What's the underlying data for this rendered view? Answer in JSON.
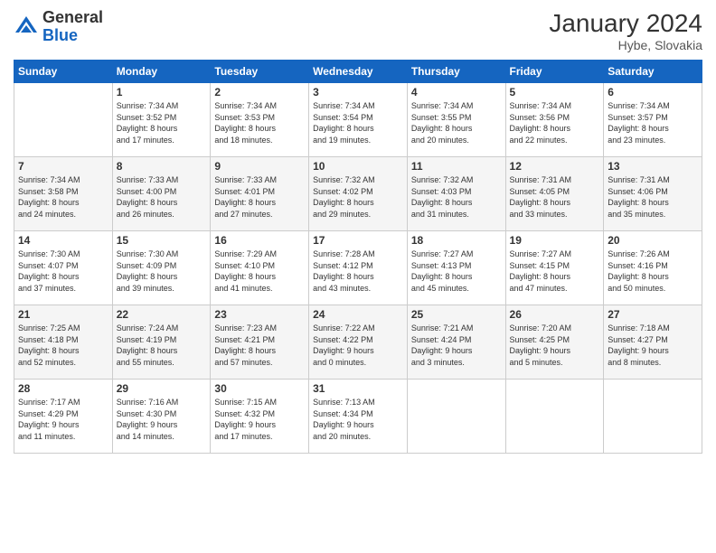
{
  "header": {
    "logo_general": "General",
    "logo_blue": "Blue",
    "month_year": "January 2024",
    "location": "Hybe, Slovakia"
  },
  "days_of_week": [
    "Sunday",
    "Monday",
    "Tuesday",
    "Wednesday",
    "Thursday",
    "Friday",
    "Saturday"
  ],
  "weeks": [
    {
      "days": [
        {
          "num": "",
          "info": ""
        },
        {
          "num": "1",
          "info": "Sunrise: 7:34 AM\nSunset: 3:52 PM\nDaylight: 8 hours\nand 17 minutes."
        },
        {
          "num": "2",
          "info": "Sunrise: 7:34 AM\nSunset: 3:53 PM\nDaylight: 8 hours\nand 18 minutes."
        },
        {
          "num": "3",
          "info": "Sunrise: 7:34 AM\nSunset: 3:54 PM\nDaylight: 8 hours\nand 19 minutes."
        },
        {
          "num": "4",
          "info": "Sunrise: 7:34 AM\nSunset: 3:55 PM\nDaylight: 8 hours\nand 20 minutes."
        },
        {
          "num": "5",
          "info": "Sunrise: 7:34 AM\nSunset: 3:56 PM\nDaylight: 8 hours\nand 22 minutes."
        },
        {
          "num": "6",
          "info": "Sunrise: 7:34 AM\nSunset: 3:57 PM\nDaylight: 8 hours\nand 23 minutes."
        }
      ]
    },
    {
      "days": [
        {
          "num": "7",
          "info": "Sunrise: 7:34 AM\nSunset: 3:58 PM\nDaylight: 8 hours\nand 24 minutes."
        },
        {
          "num": "8",
          "info": "Sunrise: 7:33 AM\nSunset: 4:00 PM\nDaylight: 8 hours\nand 26 minutes."
        },
        {
          "num": "9",
          "info": "Sunrise: 7:33 AM\nSunset: 4:01 PM\nDaylight: 8 hours\nand 27 minutes."
        },
        {
          "num": "10",
          "info": "Sunrise: 7:32 AM\nSunset: 4:02 PM\nDaylight: 8 hours\nand 29 minutes."
        },
        {
          "num": "11",
          "info": "Sunrise: 7:32 AM\nSunset: 4:03 PM\nDaylight: 8 hours\nand 31 minutes."
        },
        {
          "num": "12",
          "info": "Sunrise: 7:31 AM\nSunset: 4:05 PM\nDaylight: 8 hours\nand 33 minutes."
        },
        {
          "num": "13",
          "info": "Sunrise: 7:31 AM\nSunset: 4:06 PM\nDaylight: 8 hours\nand 35 minutes."
        }
      ]
    },
    {
      "days": [
        {
          "num": "14",
          "info": "Sunrise: 7:30 AM\nSunset: 4:07 PM\nDaylight: 8 hours\nand 37 minutes."
        },
        {
          "num": "15",
          "info": "Sunrise: 7:30 AM\nSunset: 4:09 PM\nDaylight: 8 hours\nand 39 minutes."
        },
        {
          "num": "16",
          "info": "Sunrise: 7:29 AM\nSunset: 4:10 PM\nDaylight: 8 hours\nand 41 minutes."
        },
        {
          "num": "17",
          "info": "Sunrise: 7:28 AM\nSunset: 4:12 PM\nDaylight: 8 hours\nand 43 minutes."
        },
        {
          "num": "18",
          "info": "Sunrise: 7:27 AM\nSunset: 4:13 PM\nDaylight: 8 hours\nand 45 minutes."
        },
        {
          "num": "19",
          "info": "Sunrise: 7:27 AM\nSunset: 4:15 PM\nDaylight: 8 hours\nand 47 minutes."
        },
        {
          "num": "20",
          "info": "Sunrise: 7:26 AM\nSunset: 4:16 PM\nDaylight: 8 hours\nand 50 minutes."
        }
      ]
    },
    {
      "days": [
        {
          "num": "21",
          "info": "Sunrise: 7:25 AM\nSunset: 4:18 PM\nDaylight: 8 hours\nand 52 minutes."
        },
        {
          "num": "22",
          "info": "Sunrise: 7:24 AM\nSunset: 4:19 PM\nDaylight: 8 hours\nand 55 minutes."
        },
        {
          "num": "23",
          "info": "Sunrise: 7:23 AM\nSunset: 4:21 PM\nDaylight: 8 hours\nand 57 minutes."
        },
        {
          "num": "24",
          "info": "Sunrise: 7:22 AM\nSunset: 4:22 PM\nDaylight: 9 hours\nand 0 minutes."
        },
        {
          "num": "25",
          "info": "Sunrise: 7:21 AM\nSunset: 4:24 PM\nDaylight: 9 hours\nand 3 minutes."
        },
        {
          "num": "26",
          "info": "Sunrise: 7:20 AM\nSunset: 4:25 PM\nDaylight: 9 hours\nand 5 minutes."
        },
        {
          "num": "27",
          "info": "Sunrise: 7:18 AM\nSunset: 4:27 PM\nDaylight: 9 hours\nand 8 minutes."
        }
      ]
    },
    {
      "days": [
        {
          "num": "28",
          "info": "Sunrise: 7:17 AM\nSunset: 4:29 PM\nDaylight: 9 hours\nand 11 minutes."
        },
        {
          "num": "29",
          "info": "Sunrise: 7:16 AM\nSunset: 4:30 PM\nDaylight: 9 hours\nand 14 minutes."
        },
        {
          "num": "30",
          "info": "Sunrise: 7:15 AM\nSunset: 4:32 PM\nDaylight: 9 hours\nand 17 minutes."
        },
        {
          "num": "31",
          "info": "Sunrise: 7:13 AM\nSunset: 4:34 PM\nDaylight: 9 hours\nand 20 minutes."
        },
        {
          "num": "",
          "info": ""
        },
        {
          "num": "",
          "info": ""
        },
        {
          "num": "",
          "info": ""
        }
      ]
    }
  ]
}
